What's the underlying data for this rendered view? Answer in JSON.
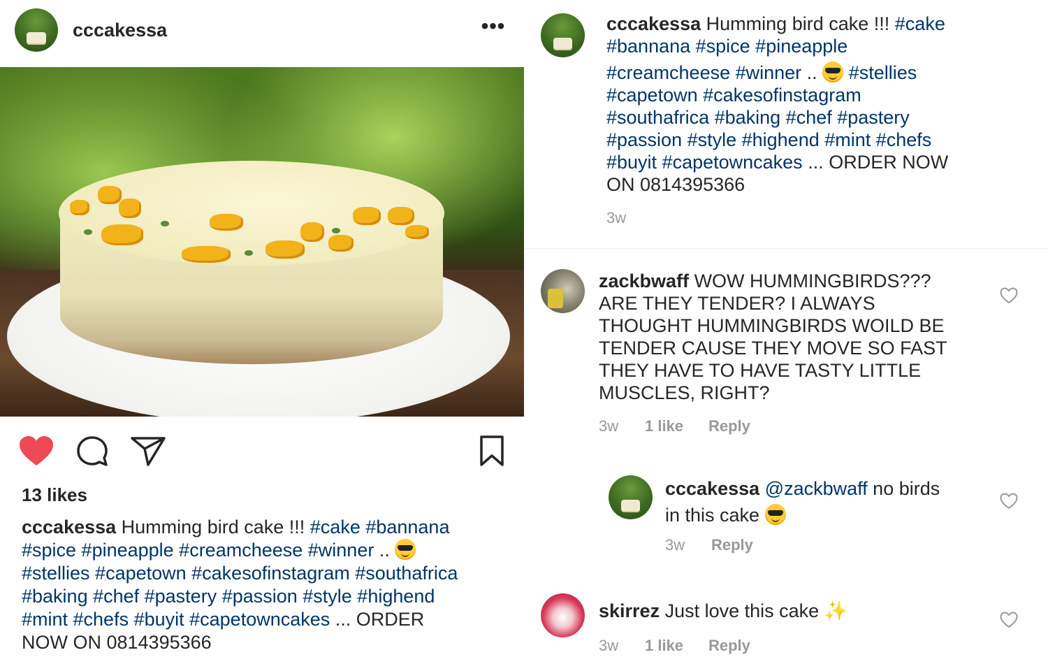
{
  "post": {
    "username": "cccakessa",
    "more_label": "•••",
    "likes": "13 likes",
    "caption": {
      "username": "cccakessa",
      "text_start": "Humming bird cake !!!",
      "tags_a": "#cake #bannana",
      "tags_b": "#spice #pineapple #creamcheese #winner",
      "dots": "..",
      "tags_c": "#stellies #capetown #cakesofinstagram #southafrica",
      "tags_d": "#baking #chef #pastery #passion #style #highend",
      "tags_e": "#mint #chefs #buyit #capetowncakes",
      "order_a": "... ORDER",
      "order_b": "NOW ON 0814395366"
    }
  },
  "side_caption": {
    "username": "cccakessa",
    "text_start": "Humming bird cake !!!",
    "l1_tag": "#cake",
    "l2": "#bannana #spice #pineapple",
    "l3_tags": "#creamcheese #winner",
    "l3_dots": "..",
    "l3_tag2": "#stellies",
    "l4": "#capetown #cakesofinstagram",
    "l5": "#southafrica #baking #chef #pastery",
    "l6": "#passion #style #highend #mint #chefs",
    "l7_tags": "#buyit #capetowncakes",
    "l7_text": "... ORDER NOW",
    "l8": "ON 0814395366",
    "time": "3w"
  },
  "comments": [
    {
      "username": "zackbwaff",
      "lines": [
        "WOW HUMMINGBIRDS???",
        "ARE THEY TENDER? I ALWAYS",
        "THOUGHT HUMMINGBIRDS WOILD BE",
        "TENDER CAUSE THEY MOVE SO FAST",
        "THEY HAVE TO HAVE TASTY LITTLE",
        "MUSCLES, RIGHT?"
      ],
      "time": "3w",
      "likes": "1 like",
      "reply": "Reply"
    },
    {
      "username": "cccakessa",
      "mention": "@zackbwaff",
      "text_a": "no birds",
      "text_b": "in this cake",
      "time": "3w",
      "reply": "Reply"
    },
    {
      "username": "skirrez",
      "text": "Just love this cake",
      "sparkles": "✨",
      "time": "3w",
      "likes": "1 like",
      "reply": "Reply"
    }
  ],
  "icons": {
    "like": "heart-filled-icon",
    "comment": "comment-bubble-icon",
    "share": "paper-plane-icon",
    "save": "bookmark-icon",
    "comment_like": "heart-outline-icon"
  },
  "colors": {
    "like_red": "#ed4956",
    "hashtag_blue": "#003569",
    "meta_gray": "#999999",
    "text": "#262626"
  }
}
